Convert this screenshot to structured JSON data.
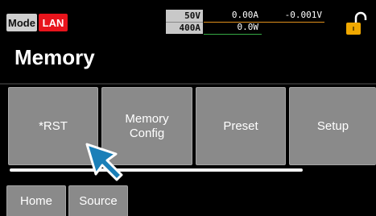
{
  "status_bar": {
    "mode_label": "Mode",
    "lan_label": "LAN",
    "voltage_range": "50V",
    "current_range": "400A",
    "current_readout": "0.00A",
    "voltage_readout": "-0.001V",
    "power_readout": "0.0W",
    "lock_icon": "unlocked-padlock-icon"
  },
  "page": {
    "title": "Memory"
  },
  "menu": {
    "items": [
      {
        "label": "*RST"
      },
      {
        "label": "Memory\nConfig"
      },
      {
        "label": "Preset"
      },
      {
        "label": "Setup"
      }
    ]
  },
  "tabs": [
    {
      "label": "Home"
    },
    {
      "label": "Source"
    }
  ],
  "colors": {
    "lan_badge": "#e8141c",
    "button_gray": "#8a8a8a",
    "lock_gold": "#f0a800",
    "cursor_blue": "#1a7fb8",
    "current_underline": "#e0901c",
    "power_underline": "#35a845"
  }
}
